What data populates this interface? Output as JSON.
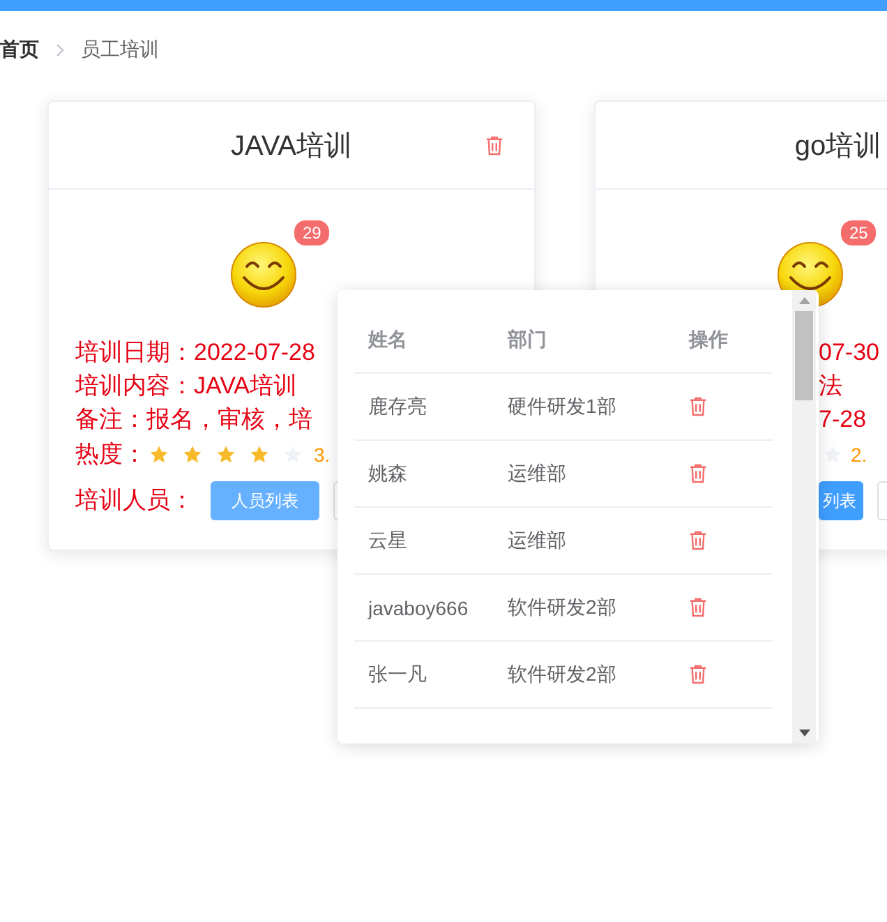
{
  "breadcrumb": [
    {
      "label": "首页",
      "current": false
    },
    {
      "label": "员工培训",
      "current": true
    }
  ],
  "cards": [
    {
      "title": "JAVA培训",
      "badge": "29",
      "fragment": false,
      "lines": [
        {
          "kind": "text",
          "text": "培训日期：2022-07-28"
        },
        {
          "kind": "text",
          "text": "培训内容：JAVA培训"
        },
        {
          "kind": "text",
          "text": "备注：报名，审核，培"
        },
        {
          "kind": "rating",
          "label": "热度：",
          "stars": 4,
          "reading": "3."
        },
        {
          "kind": "buttons",
          "label": "培训人员：",
          "buttons": [
            "人员列表"
          ]
        }
      ]
    },
    {
      "title": "go培训",
      "badge": "25",
      "fragment": true,
      "lines": [
        {
          "kind": "text",
          "text": "07-30"
        },
        {
          "kind": "text",
          "text": "法"
        },
        {
          "kind": "text",
          "text": "7-28"
        },
        {
          "kind": "rating",
          "reading": "2."
        },
        {
          "kind": "buttons",
          "buttons": [
            "列表"
          ]
        }
      ]
    }
  ],
  "popover": {
    "columns": [
      "姓名",
      "部门",
      "操作"
    ],
    "rows": [
      {
        "name": "鹿存亮",
        "department": "硬件研发1部"
      },
      {
        "name": "姚森",
        "department": "运维部"
      },
      {
        "name": "云星",
        "department": "运维部"
      },
      {
        "name": "javaboy666",
        "department": "软件研发2部"
      },
      {
        "name": "张一凡",
        "department": "软件研发2部"
      }
    ]
  }
}
